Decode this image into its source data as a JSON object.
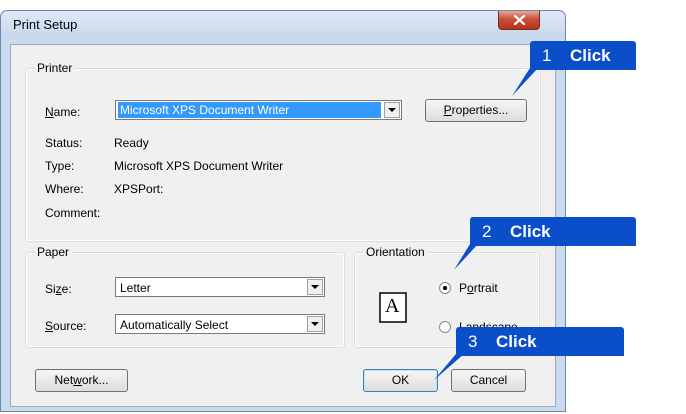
{
  "window": {
    "title": "Print Setup"
  },
  "printer": {
    "group_label": "Printer",
    "name_label": "Name:",
    "name_value": "Microsoft XPS Document Writer",
    "properties_button": "Properties...",
    "status_label": "Status:",
    "status_value": "Ready",
    "type_label": "Type:",
    "type_value": "Microsoft XPS Document Writer",
    "where_label": "Where:",
    "where_value": "XPSPort:",
    "comment_label": "Comment:"
  },
  "paper": {
    "group_label": "Paper",
    "size_label": "Size:",
    "size_value": "Letter",
    "source_label": "Source:",
    "source_value": "Automatically Select"
  },
  "orientation": {
    "group_label": "Orientation",
    "portrait_label": "Portrait",
    "landscape_label": "Landscape",
    "selected": "Portrait",
    "preview_glyph": "A"
  },
  "buttons": {
    "network": "Network...",
    "ok": "OK",
    "cancel": "Cancel"
  },
  "callouts": [
    {
      "num": "1",
      "word": "Click"
    },
    {
      "num": "2",
      "word": "Click"
    },
    {
      "num": "3",
      "word": "Click"
    }
  ],
  "colors": {
    "callout": "#0a4fc9",
    "selection": "#3399ff",
    "close_button": "#c9503a"
  }
}
